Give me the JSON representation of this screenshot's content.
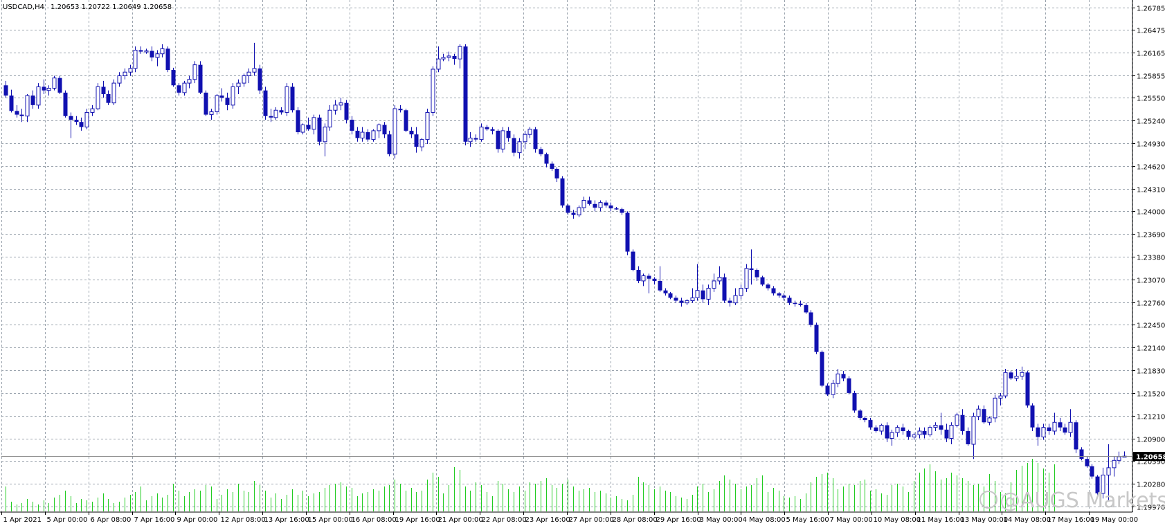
{
  "header": {
    "symbol_timeframe": "USDCAD,H4",
    "ohlc": "1.20653 1.20722 1.20649 1.20658"
  },
  "watermark": "@AUGS Markets",
  "colors": {
    "background": "#ffffff",
    "grid": "#9aa3ad",
    "candle": "#1010b0",
    "volume": "#22cc22",
    "price_line": "#8c8c8c",
    "price_label_bg": "#000000",
    "price_label_text": "#ffffff"
  },
  "chart_data": {
    "type": "candlestick",
    "symbol": "USDCAD",
    "timeframe": "H4",
    "grid": true,
    "price_axis": "right",
    "ylim": [
      1.1997,
      1.2679
    ],
    "current_price": "1.20658",
    "y_ticks": [
      "1.26785",
      "1.26475",
      "1.26165",
      "1.25855",
      "1.25550",
      "1.25240",
      "1.24930",
      "1.24620",
      "1.24310",
      "1.24000",
      "1.23690",
      "1.23380",
      "1.23070",
      "1.22760",
      "1.22450",
      "1.22140",
      "1.21830",
      "1.21520",
      "1.21210",
      "1.20900",
      "1.20590",
      "1.20280",
      "1.19970"
    ],
    "x_ticks": [
      "1 Apr 2021",
      "5 Apr 00:00",
      "6 Apr 08:00",
      "7 Apr 16:00",
      "9 Apr 00:00",
      "12 Apr 08:00",
      "13 Apr 16:00",
      "15 Apr 00:00",
      "16 Apr 08:00",
      "19 Apr 16:00",
      "21 Apr 00:00",
      "22 Apr 08:00",
      "23 Apr 16:00",
      "27 Apr 00:00",
      "28 Apr 08:00",
      "29 Apr 16:00",
      "3 May 00:00",
      "4 May 08:00",
      "5 May 16:00",
      "7 May 00:00",
      "10 May 08:00",
      "11 May 16:00",
      "13 May 00:00",
      "14 May 08:00",
      "17 May 16:00",
      "19 May 00:00"
    ],
    "candles": [
      [
        1.2572,
        1.2578,
        1.2555,
        1.2558
      ],
      [
        1.2558,
        1.2566,
        1.2535,
        1.2537
      ],
      [
        1.2537,
        1.2545,
        1.2528,
        1.2532
      ],
      [
        1.2532,
        1.254,
        1.2522,
        1.253
      ],
      [
        1.253,
        1.256,
        1.2522,
        1.2558
      ],
      [
        1.2558,
        1.2565,
        1.254,
        1.2545
      ],
      [
        1.2545,
        1.2575,
        1.254,
        1.257
      ],
      [
        1.257,
        1.258,
        1.256,
        1.2565
      ],
      [
        1.2565,
        1.2572,
        1.2558,
        1.2568
      ],
      [
        1.2568,
        1.2585,
        1.2565,
        1.2582
      ],
      [
        1.2582,
        1.2585,
        1.256,
        1.2562
      ],
      [
        1.2562,
        1.2565,
        1.2528,
        1.253
      ],
      [
        1.253,
        1.2535,
        1.25,
        1.2525
      ],
      [
        1.2525,
        1.253,
        1.2518,
        1.2522
      ],
      [
        1.2522,
        1.2528,
        1.251,
        1.2515
      ],
      [
        1.2515,
        1.254,
        1.2512,
        1.2535
      ],
      [
        1.2535,
        1.2545,
        1.253,
        1.254
      ],
      [
        1.254,
        1.2575,
        1.2538,
        1.257
      ],
      [
        1.257,
        1.2578,
        1.2555,
        1.256
      ],
      [
        1.256,
        1.2565,
        1.2545,
        1.2548
      ],
      [
        1.2548,
        1.258,
        1.2545,
        1.2575
      ],
      [
        1.2575,
        1.259,
        1.257,
        1.2585
      ],
      [
        1.2585,
        1.2595,
        1.258,
        1.259
      ],
      [
        1.259,
        1.26,
        1.2585,
        1.2595
      ],
      [
        1.2595,
        1.2625,
        1.259,
        1.262
      ],
      [
        1.262,
        1.2625,
        1.2615,
        1.2618
      ],
      [
        1.2618,
        1.2622,
        1.2615,
        1.2619
      ],
      [
        1.2619,
        1.2625,
        1.2605,
        1.261
      ],
      [
        1.261,
        1.262,
        1.2598,
        1.2615
      ],
      [
        1.2615,
        1.2628,
        1.261,
        1.2622
      ],
      [
        1.2622,
        1.2625,
        1.259,
        1.2593
      ],
      [
        1.2593,
        1.2596,
        1.257,
        1.2572
      ],
      [
        1.2572,
        1.2575,
        1.2558,
        1.2562
      ],
      [
        1.2562,
        1.2578,
        1.2558,
        1.2575
      ],
      [
        1.2575,
        1.2585,
        1.2568,
        1.258
      ],
      [
        1.258,
        1.2605,
        1.2575,
        1.26
      ],
      [
        1.26,
        1.2605,
        1.256,
        1.2562
      ],
      [
        1.2562,
        1.2565,
        1.253,
        1.2532
      ],
      [
        1.2532,
        1.254,
        1.2525,
        1.2536
      ],
      [
        1.2536,
        1.256,
        1.2532,
        1.2558
      ],
      [
        1.2558,
        1.2568,
        1.255,
        1.2555
      ],
      [
        1.2555,
        1.2562,
        1.2538,
        1.2545
      ],
      [
        1.2545,
        1.2575,
        1.254,
        1.257
      ],
      [
        1.257,
        1.258,
        1.256,
        1.2575
      ],
      [
        1.2575,
        1.2588,
        1.257,
        1.2585
      ],
      [
        1.2585,
        1.2595,
        1.2575,
        1.259
      ],
      [
        1.259,
        1.263,
        1.2585,
        1.2595
      ],
      [
        1.2595,
        1.26,
        1.256,
        1.2565
      ],
      [
        1.2565,
        1.257,
        1.2525,
        1.253
      ],
      [
        1.253,
        1.254,
        1.2522,
        1.2528
      ],
      [
        1.2528,
        1.2542,
        1.2525,
        1.2538
      ],
      [
        1.2538,
        1.2542,
        1.2532,
        1.2535
      ],
      [
        1.2535,
        1.2575,
        1.253,
        1.257
      ],
      [
        1.257,
        1.2575,
        1.2535,
        1.2538
      ],
      [
        1.2538,
        1.2542,
        1.2505,
        1.2508
      ],
      [
        1.2508,
        1.252,
        1.2505,
        1.2518
      ],
      [
        1.2518,
        1.2528,
        1.251,
        1.2512
      ],
      [
        1.2512,
        1.2532,
        1.2505,
        1.2528
      ],
      [
        1.2528,
        1.2532,
        1.249,
        1.2495
      ],
      [
        1.2495,
        1.252,
        1.2475,
        1.2515
      ],
      [
        1.2515,
        1.2545,
        1.251,
        1.2538
      ],
      [
        1.2538,
        1.2552,
        1.2532,
        1.2545
      ],
      [
        1.2545,
        1.2555,
        1.2538,
        1.2548
      ],
      [
        1.2548,
        1.2552,
        1.252,
        1.2525
      ],
      [
        1.2525,
        1.253,
        1.2505,
        1.251
      ],
      [
        1.251,
        1.2515,
        1.2495,
        1.25
      ],
      [
        1.25,
        1.2515,
        1.2495,
        1.2508
      ],
      [
        1.2508,
        1.2512,
        1.2495,
        1.2498
      ],
      [
        1.2498,
        1.2512,
        1.2495,
        1.251
      ],
      [
        1.251,
        1.252,
        1.25,
        1.2518
      ],
      [
        1.2518,
        1.2522,
        1.25,
        1.2505
      ],
      [
        1.2505,
        1.251,
        1.2475,
        1.2478
      ],
      [
        1.2478,
        1.2545,
        1.2472,
        1.254
      ],
      [
        1.254,
        1.2545,
        1.2535,
        1.2538
      ],
      [
        1.2538,
        1.254,
        1.2508,
        1.251
      ],
      [
        1.251,
        1.2515,
        1.25,
        1.2505
      ],
      [
        1.2505,
        1.2515,
        1.248,
        1.2488
      ],
      [
        1.2488,
        1.25,
        1.2482,
        1.2498
      ],
      [
        1.2498,
        1.254,
        1.2492,
        1.2535
      ],
      [
        1.2535,
        1.2598,
        1.253,
        1.2594
      ],
      [
        1.2594,
        1.2625,
        1.259,
        1.2608
      ],
      [
        1.2608,
        1.2615,
        1.2605,
        1.261
      ],
      [
        1.261,
        1.2618,
        1.2605,
        1.2612
      ],
      [
        1.2612,
        1.2615,
        1.26,
        1.2608
      ],
      [
        1.2608,
        1.2628,
        1.2595,
        1.2625
      ],
      [
        1.2625,
        1.2628,
        1.249,
        1.2495
      ],
      [
        1.2495,
        1.2508,
        1.2488,
        1.25
      ],
      [
        1.25,
        1.2505,
        1.2495,
        1.2498
      ],
      [
        1.2498,
        1.252,
        1.2495,
        1.2515
      ],
      [
        1.2515,
        1.2518,
        1.251,
        1.2512
      ],
      [
        1.2512,
        1.2515,
        1.2505,
        1.251
      ],
      [
        1.251,
        1.2512,
        1.248,
        1.2485
      ],
      [
        1.2485,
        1.2515,
        1.248,
        1.251
      ],
      [
        1.251,
        1.2515,
        1.2495,
        1.25
      ],
      [
        1.25,
        1.2505,
        1.2475,
        1.248
      ],
      [
        1.248,
        1.25,
        1.2472,
        1.2495
      ],
      [
        1.2495,
        1.251,
        1.2485,
        1.2505
      ],
      [
        1.2505,
        1.2515,
        1.25,
        1.2512
      ],
      [
        1.2512,
        1.2515,
        1.248,
        1.2485
      ],
      [
        1.2485,
        1.2488,
        1.2475,
        1.2478
      ],
      [
        1.2478,
        1.248,
        1.246,
        1.2465
      ],
      [
        1.2465,
        1.2468,
        1.2455,
        1.2458
      ],
      [
        1.2458,
        1.246,
        1.244,
        1.2445
      ],
      [
        1.2445,
        1.2448,
        1.2405,
        1.2408
      ],
      [
        1.2408,
        1.241,
        1.2395,
        1.2398
      ],
      [
        1.2398,
        1.2402,
        1.239,
        1.2395
      ],
      [
        1.2395,
        1.2408,
        1.2392,
        1.2405
      ],
      [
        1.2405,
        1.242,
        1.24,
        1.2415
      ],
      [
        1.2415,
        1.242,
        1.2408,
        1.241
      ],
      [
        1.241,
        1.2415,
        1.24,
        1.2405
      ],
      [
        1.2405,
        1.2415,
        1.24,
        1.2412
      ],
      [
        1.2412,
        1.2415,
        1.2405,
        1.2408
      ],
      [
        1.2408,
        1.2412,
        1.24,
        1.2404
      ],
      [
        1.2404,
        1.2406,
        1.2402,
        1.2403
      ],
      [
        1.2403,
        1.2405,
        1.2395,
        1.2398
      ],
      [
        1.2398,
        1.24,
        1.234,
        1.2345
      ],
      [
        1.2345,
        1.2348,
        1.2318,
        1.232
      ],
      [
        1.232,
        1.2325,
        1.2302,
        1.2305
      ],
      [
        1.2305,
        1.2315,
        1.2298,
        1.2312
      ],
      [
        1.2312,
        1.2315,
        1.2288,
        1.2308
      ],
      [
        1.2308,
        1.231,
        1.23,
        1.2305
      ],
      [
        1.2305,
        1.2325,
        1.229,
        1.2292
      ],
      [
        1.2292,
        1.2295,
        1.2285,
        1.2288
      ],
      [
        1.2288,
        1.229,
        1.228,
        1.2282
      ],
      [
        1.2282,
        1.2285,
        1.2275,
        1.2278
      ],
      [
        1.2278,
        1.2282,
        1.227,
        1.2275
      ],
      [
        1.2275,
        1.228,
        1.2272,
        1.2278
      ],
      [
        1.2278,
        1.2295,
        1.2275,
        1.2282
      ],
      [
        1.2282,
        1.2328,
        1.2278,
        1.2292
      ],
      [
        1.2292,
        1.23,
        1.2275,
        1.228
      ],
      [
        1.228,
        1.23,
        1.2272,
        1.2295
      ],
      [
        1.2295,
        1.2315,
        1.229,
        1.2305
      ],
      [
        1.2305,
        1.2325,
        1.23,
        1.231
      ],
      [
        1.231,
        1.2315,
        1.2275,
        1.2278
      ],
      [
        1.2278,
        1.2282,
        1.227,
        1.2275
      ],
      [
        1.2275,
        1.2295,
        1.2272,
        1.2285
      ],
      [
        1.2285,
        1.23,
        1.228,
        1.2295
      ],
      [
        1.2295,
        1.2328,
        1.229,
        1.2322
      ],
      [
        1.2322,
        1.2348,
        1.23,
        1.232
      ],
      [
        1.232,
        1.2322,
        1.2305,
        1.231
      ],
      [
        1.231,
        1.2312,
        1.2298,
        1.23
      ],
      [
        1.23,
        1.2302,
        1.2292,
        1.2295
      ],
      [
        1.2295,
        1.2298,
        1.2285,
        1.2288
      ],
      [
        1.2288,
        1.229,
        1.2282,
        1.2285
      ],
      [
        1.2285,
        1.2288,
        1.2278,
        1.2282
      ],
      [
        1.2282,
        1.2285,
        1.2272,
        1.2275
      ],
      [
        1.2275,
        1.2278,
        1.227,
        1.2274
      ],
      [
        1.2274,
        1.2278,
        1.227,
        1.2272
      ],
      [
        1.2272,
        1.2275,
        1.226,
        1.2262
      ],
      [
        1.2262,
        1.2265,
        1.2242,
        1.2245
      ],
      [
        1.2245,
        1.2248,
        1.2205,
        1.2208
      ],
      [
        1.2208,
        1.221,
        1.216,
        1.2162
      ],
      [
        1.2162,
        1.2165,
        1.2148,
        1.215
      ],
      [
        1.215,
        1.217,
        1.2145,
        1.2165
      ],
      [
        1.2165,
        1.2185,
        1.216,
        1.2178
      ],
      [
        1.2178,
        1.2182,
        1.2168,
        1.2172
      ],
      [
        1.2172,
        1.2175,
        1.215,
        1.2152
      ],
      [
        1.2152,
        1.2155,
        1.2125,
        1.2128
      ],
      [
        1.2128,
        1.213,
        1.2115,
        1.2118
      ],
      [
        1.2118,
        1.212,
        1.2112,
        1.2115
      ],
      [
        1.2115,
        1.2118,
        1.2102,
        1.2105
      ],
      [
        1.2105,
        1.2108,
        1.2098,
        1.21
      ],
      [
        1.21,
        1.211,
        1.2095,
        1.2108
      ],
      [
        1.2108,
        1.2112,
        1.2085,
        1.209
      ],
      [
        1.209,
        1.2102,
        1.208,
        1.2098
      ],
      [
        1.2098,
        1.2108,
        1.2092,
        1.2105
      ],
      [
        1.2105,
        1.211,
        1.2095,
        1.21
      ],
      [
        1.21,
        1.2102,
        1.2088,
        1.2092
      ],
      [
        1.2092,
        1.2098,
        1.2088,
        1.2095
      ],
      [
        1.2095,
        1.2105,
        1.209,
        1.21
      ],
      [
        1.21,
        1.2105,
        1.209,
        1.2095
      ],
      [
        1.2095,
        1.2108,
        1.2092,
        1.2105
      ],
      [
        1.2105,
        1.2112,
        1.21,
        1.2108
      ],
      [
        1.2108,
        1.2125,
        1.2095,
        1.2102
      ],
      [
        1.2102,
        1.211,
        1.2085,
        1.209
      ],
      [
        1.209,
        1.2112,
        1.2082,
        1.2108
      ],
      [
        1.2108,
        1.2125,
        1.2105,
        1.2122
      ],
      [
        1.2122,
        1.213,
        1.2095,
        1.21
      ],
      [
        1.21,
        1.2105,
        1.208,
        1.2082
      ],
      [
        1.2082,
        1.2125,
        1.2062,
        1.212
      ],
      [
        1.212,
        1.2135,
        1.2115,
        1.213
      ],
      [
        1.213,
        1.2135,
        1.211,
        1.2112
      ],
      [
        1.2112,
        1.212,
        1.2108,
        1.2118
      ],
      [
        1.2118,
        1.215,
        1.2112,
        1.2145
      ],
      [
        1.2145,
        1.2152,
        1.2135,
        1.2148
      ],
      [
        1.2148,
        1.2185,
        1.2145,
        1.218
      ],
      [
        1.218,
        1.2182,
        1.217,
        1.2172
      ],
      [
        1.2172,
        1.2185,
        1.2168,
        1.2175
      ],
      [
        1.2175,
        1.2188,
        1.217,
        1.218
      ],
      [
        1.218,
        1.2182,
        1.2132,
        1.2135
      ],
      [
        1.2135,
        1.2138,
        1.21,
        1.2105
      ],
      [
        1.2105,
        1.211,
        1.208,
        1.2092
      ],
      [
        1.2092,
        1.211,
        1.2088,
        1.2105
      ],
      [
        1.2105,
        1.211,
        1.2095,
        1.21
      ],
      [
        1.21,
        1.2125,
        1.2095,
        1.2112
      ],
      [
        1.2112,
        1.2118,
        1.21,
        1.2105
      ],
      [
        1.2105,
        1.211,
        1.2095,
        1.2098
      ],
      [
        1.2098,
        1.213,
        1.2092,
        1.2112
      ],
      [
        1.2112,
        1.2115,
        1.207,
        1.2075
      ],
      [
        1.2075,
        1.2078,
        1.206,
        1.2062
      ],
      [
        1.2062,
        1.2065,
        1.205,
        1.2052
      ],
      [
        1.2052,
        1.2055,
        1.2035,
        1.2038
      ],
      [
        1.2038,
        1.204,
        1.201,
        1.2015
      ],
      [
        1.2015,
        1.205,
        1.2008,
        1.204
      ],
      [
        1.204,
        1.2082,
        1.2005,
        1.205
      ],
      [
        1.205,
        1.2065,
        1.2038,
        1.206
      ],
      [
        1.206,
        1.2072,
        1.2055,
        1.2065
      ],
      [
        1.20653,
        1.20722,
        1.20649,
        1.20658
      ]
    ],
    "volume": [
      36,
      14,
      10,
      12,
      18,
      14,
      10,
      16,
      12,
      20,
      24,
      30,
      22,
      12,
      18,
      16,
      14,
      20,
      26,
      18,
      12,
      14,
      20,
      24,
      28,
      36,
      16,
      22,
      26,
      20,
      24,
      40,
      30,
      22,
      28,
      32,
      30,
      38,
      36,
      18,
      24,
      32,
      28,
      40,
      30,
      28,
      44,
      38,
      30,
      20,
      26,
      18,
      24,
      32,
      24,
      30,
      22,
      26,
      28,
      34,
      38,
      40,
      42,
      36,
      34,
      22,
      26,
      28,
      32,
      30,
      36,
      38,
      46,
      40,
      30,
      34,
      28,
      30,
      46,
      56,
      50,
      26,
      38,
      64,
      60,
      36,
      30,
      42,
      38,
      28,
      22,
      44,
      40,
      32,
      28,
      36,
      30,
      42,
      40,
      44,
      48,
      38,
      34,
      40,
      46,
      36,
      30,
      32,
      34,
      28,
      30,
      26,
      20,
      22,
      18,
      16,
      24,
      50,
      42,
      38,
      32,
      36,
      30,
      28,
      22,
      20,
      18,
      24,
      36,
      40,
      28,
      32,
      44,
      52,
      46,
      40,
      32,
      36,
      38,
      48,
      52,
      28,
      34,
      30,
      22,
      20,
      22,
      18,
      26,
      42,
      50,
      54,
      56,
      48,
      32,
      36,
      40,
      38,
      44,
      46,
      30,
      32,
      26,
      24,
      38,
      40,
      36,
      28,
      44,
      56,
      62,
      68,
      58,
      46,
      48,
      56,
      52,
      48,
      44,
      38,
      40,
      36,
      54,
      44,
      28,
      26,
      42,
      60,
      66,
      70,
      76,
      70,
      62,
      56,
      68
    ]
  }
}
